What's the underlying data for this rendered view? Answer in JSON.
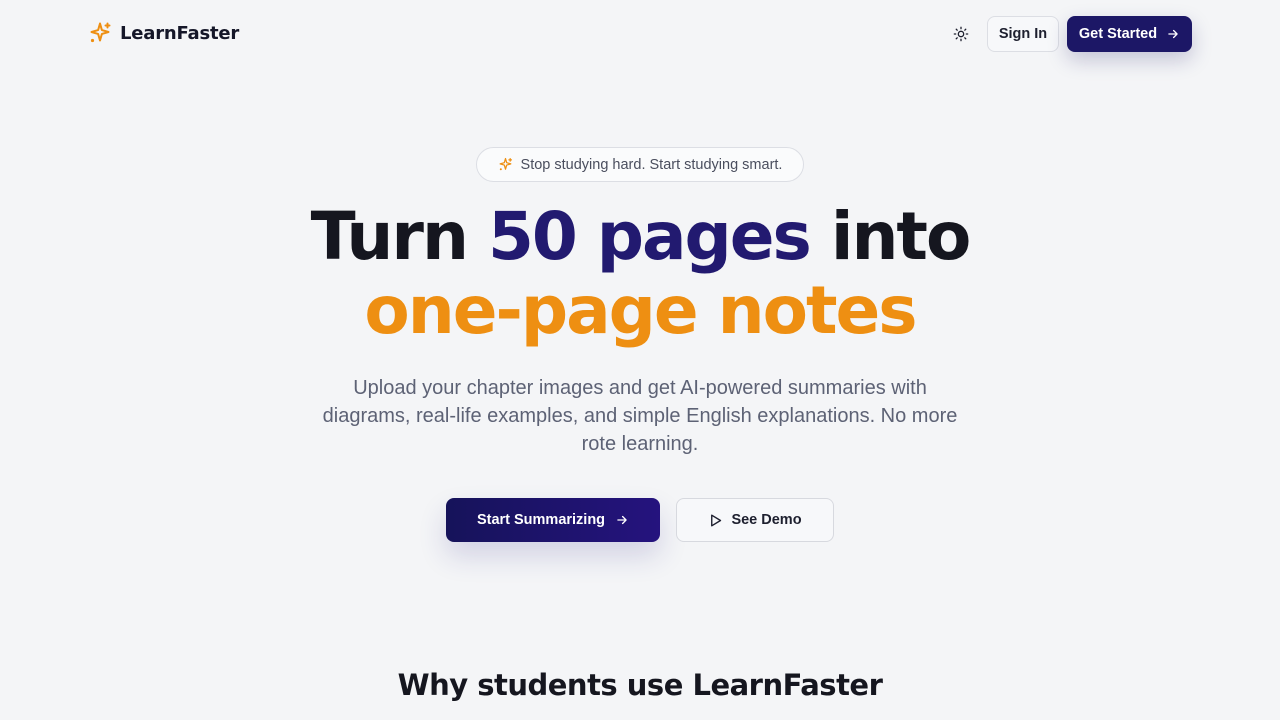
{
  "header": {
    "brand_name": "LearnFaster",
    "brand_icon": "sparkles-icon",
    "theme_toggle_icon": "sun-icon",
    "sign_in_label": "Sign In",
    "get_started_label": "Get Started"
  },
  "hero": {
    "pill_icon": "sparkles-icon",
    "pill_text": "Stop studying hard. Start studying smart.",
    "headline_part1": "Turn ",
    "headline_highlight": "50 pages",
    "headline_part2": " into",
    "headline_line2": "one-page notes",
    "subtitle": "Upload your chapter images and get AI-powered summaries with diagrams, real-life examples, and simple English explanations. No more rote learning.",
    "primary_cta_label": "Start Summarizing",
    "secondary_cta_label": "See Demo",
    "secondary_cta_icon": "play-icon"
  },
  "features": {
    "title": "Why students use LearnFaster"
  },
  "colors": {
    "primary": "#1c1766",
    "accent": "#ee8f12",
    "background": "#f4f5f7"
  }
}
